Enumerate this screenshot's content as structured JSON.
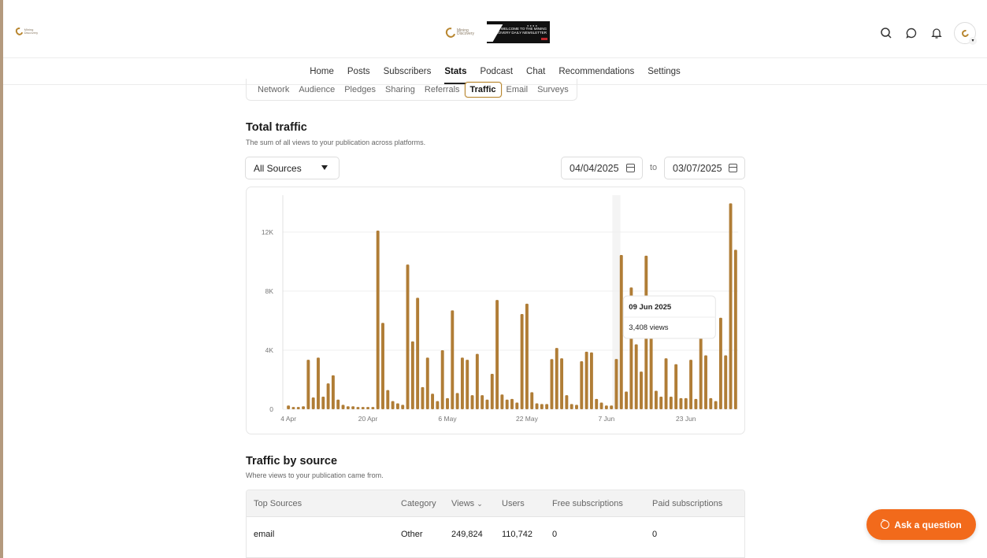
{
  "header": {
    "logo_text": "Mining Discovery",
    "banner_text": "WELCOME TO THE MINING DISCOVERY DAILY NEWSLETTER"
  },
  "nav": {
    "items": [
      "Home",
      "Posts",
      "Subscribers",
      "Stats",
      "Podcast",
      "Chat",
      "Recommendations",
      "Settings"
    ],
    "active": "Stats"
  },
  "subtabs": {
    "items": [
      "Network",
      "Audience",
      "Pledges",
      "Sharing",
      "Referrals",
      "Traffic",
      "Email",
      "Surveys"
    ],
    "active": "Traffic"
  },
  "total_traffic": {
    "title": "Total traffic",
    "subtitle": "The sum of all views to your publication across platforms."
  },
  "filters": {
    "source": "All Sources",
    "date_from": "04/04/2025",
    "to_label": "to",
    "date_to": "03/07/2025"
  },
  "tooltip": {
    "date": "09 Jun 2025",
    "value": "3,408 views"
  },
  "chart_data": {
    "type": "bar",
    "title": "",
    "xlabel": "",
    "ylabel": "",
    "ylim": [
      0,
      14500
    ],
    "y_ticks": [
      "0",
      "4K",
      "8K",
      "12K"
    ],
    "y_tick_values": [
      0,
      4000,
      8000,
      12000
    ],
    "x_tick_labels": [
      "4 Apr",
      "20 Apr",
      "6 May",
      "22 May",
      "7 Jun",
      "23 Jun"
    ],
    "x_tick_indices": [
      0,
      16,
      32,
      48,
      64,
      80
    ],
    "hovered_index": 66,
    "color": "#b07d36",
    "values": [
      250,
      150,
      150,
      200,
      3350,
      800,
      3500,
      850,
      1750,
      2300,
      650,
      300,
      200,
      200,
      150,
      150,
      150,
      150,
      12100,
      5850,
      1300,
      550,
      400,
      300,
      9800,
      4600,
      7550,
      1500,
      3500,
      1050,
      550,
      4000,
      750,
      6700,
      1100,
      3500,
      3350,
      950,
      3750,
      950,
      650,
      2400,
      7400,
      1000,
      650,
      700,
      450,
      6450,
      7150,
      1150,
      400,
      350,
      350,
      3400,
      4150,
      3450,
      950,
      350,
      300,
      3250,
      3900,
      3850,
      700,
      450,
      250,
      250,
      3408,
      10450,
      1200,
      8250,
      4400,
      2550,
      10400,
      5000,
      1250,
      850,
      3450,
      850,
      3050,
      750,
      750,
      3350,
      700,
      5050,
      3650,
      750,
      550,
      6200,
      3650,
      13950,
      10800
    ]
  },
  "traffic_by_source": {
    "title": "Traffic by source",
    "subtitle": "Where views to your publication came from.",
    "columns": [
      "Top Sources",
      "Category",
      "Views",
      "Users",
      "Free subscriptions",
      "Paid subscriptions"
    ],
    "rows": [
      [
        "email",
        "Other",
        "249,824",
        "110,742",
        "0",
        "0"
      ]
    ]
  },
  "ask_button": "Ask a question"
}
